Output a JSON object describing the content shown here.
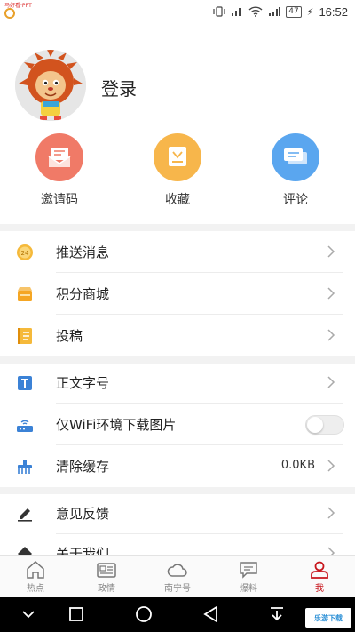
{
  "status_bar": {
    "watermark": "马好看·PPT",
    "battery": "47",
    "time": "16:52",
    "icons": [
      "vibrate-icon",
      "signal-icon",
      "wifi-icon",
      "cellular-icon",
      "battery-icon"
    ]
  },
  "profile": {
    "login_label": "登录",
    "avatar_icon": "lion-cartoon-avatar"
  },
  "quick_actions": [
    {
      "label": "邀请码",
      "icon": "envelope-icon",
      "color": "#f07a67"
    },
    {
      "label": "收藏",
      "icon": "bookmark-icon",
      "color": "#f7b64b"
    },
    {
      "label": "评论",
      "icon": "comment-icon",
      "color": "#5aa6ef"
    }
  ],
  "menu": {
    "push": {
      "label": "推送消息",
      "icon": "badge-24-icon"
    },
    "points": {
      "label": "积分商城",
      "icon": "store-icon"
    },
    "submit": {
      "label": "投稿",
      "icon": "notebook-icon"
    },
    "font_size": {
      "label": "正文字号",
      "icon": "text-size-icon"
    },
    "wifi_images": {
      "label": "仅WiFi环境下载图片",
      "icon": "router-icon",
      "enabled": false
    },
    "cache": {
      "label": "清除缓存",
      "icon": "broom-icon",
      "value": "0.0KB"
    },
    "feedback": {
      "label": "意见反馈",
      "icon": "pencil-icon"
    },
    "about": {
      "label": "关于我们",
      "icon": "info-icon"
    }
  },
  "tabs": [
    {
      "label": "热点",
      "icon": "home-icon",
      "active": false
    },
    {
      "label": "政情",
      "icon": "newspaper-icon",
      "active": false
    },
    {
      "label": "南宁号",
      "icon": "cloud-icon",
      "active": false
    },
    {
      "label": "爆料",
      "icon": "chat-icon",
      "active": false
    },
    {
      "label": "我",
      "icon": "person-icon",
      "active": true
    }
  ],
  "colors": {
    "accent": "#c8161d",
    "divider": "#ececec",
    "section_gap": "#f2f2f2"
  },
  "nav_watermark": "乐游下载"
}
